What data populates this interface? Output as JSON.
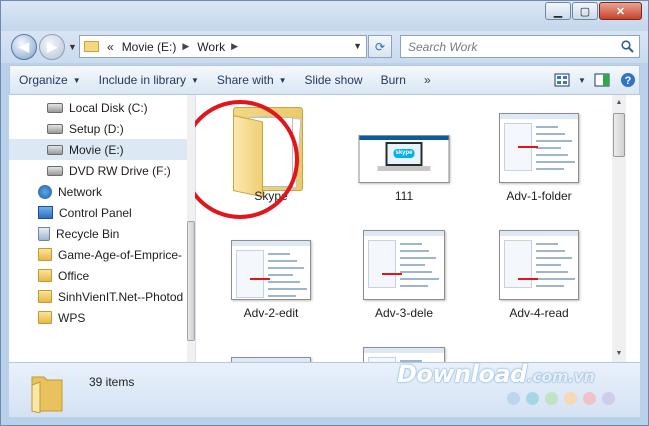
{
  "window": {
    "caption_buttons": {
      "minimize_icon": "minimize-icon",
      "maximize_icon": "maximize-icon",
      "close_icon": "close-icon"
    }
  },
  "address": {
    "overflow": "«",
    "segments": [
      "Movie (E:)",
      "Work"
    ],
    "search_placeholder": "Search Work"
  },
  "toolbar": {
    "organize": "Organize",
    "include_in_library": "Include in library",
    "share_with": "Share with",
    "slide_show": "Slide show",
    "burn": "Burn",
    "more": "»"
  },
  "sidebar": {
    "items": [
      {
        "label": "Local Disk (C:)",
        "icon": "drive-icon",
        "kind": "drive"
      },
      {
        "label": "Setup (D:)",
        "icon": "drive-icon",
        "kind": "drive"
      },
      {
        "label": "Movie  (E:)",
        "icon": "drive-icon",
        "kind": "drive",
        "selected": true
      },
      {
        "label": "DVD RW Drive (F:)",
        "icon": "dvd-drive-icon",
        "kind": "dvd"
      },
      {
        "label": "Network",
        "icon": "network-icon",
        "kind": "net"
      },
      {
        "label": "Control Panel",
        "icon": "control-panel-icon",
        "kind": "cp"
      },
      {
        "label": "Recycle Bin",
        "icon": "recycle-bin-icon",
        "kind": "bin"
      },
      {
        "label": "Game-Age-of-Emprice-",
        "icon": "folder-icon",
        "kind": "folder"
      },
      {
        "label": "Office",
        "icon": "folder-icon",
        "kind": "folder"
      },
      {
        "label": "SinhVienIT.Net--Photod",
        "icon": "folder-icon",
        "kind": "folder"
      },
      {
        "label": "WPS",
        "icon": "folder-icon",
        "kind": "folder"
      }
    ]
  },
  "files": [
    {
      "name": "Skype",
      "kind": "folder",
      "highlighted": true
    },
    {
      "name": "111",
      "kind": "image-skype"
    },
    {
      "name": "Adv-1-folder",
      "kind": "screenshot"
    },
    {
      "name": "Adv-2-edit",
      "kind": "screenshot"
    },
    {
      "name": "Adv-3-dele",
      "kind": "screenshot"
    },
    {
      "name": "Adv-4-read",
      "kind": "screenshot"
    },
    {
      "name": "",
      "kind": "screenshot"
    },
    {
      "name": "",
      "kind": "screenshot"
    }
  ],
  "details": {
    "count": "39 items"
  },
  "watermark": {
    "text": "Download",
    "domain": ".com.vn",
    "dot_colors": [
      "#bcd6ee",
      "#a6d6e6",
      "#bfe3c3",
      "#f4d9b3",
      "#f0c2c6",
      "#cfcdea"
    ]
  },
  "colors": {
    "highlight_ring": "#e3151b",
    "window_frame": "#b9d1ea"
  }
}
